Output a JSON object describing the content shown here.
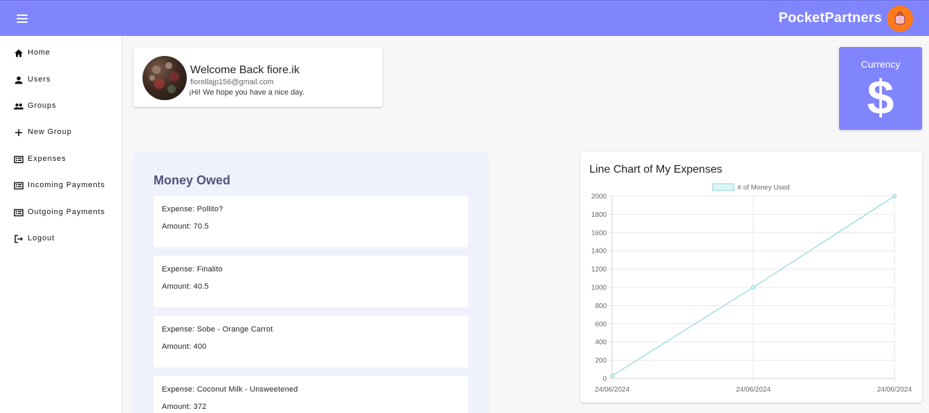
{
  "appbar": {
    "brand": "PocketPartners",
    "accent_color": "#8085fe",
    "menu_icon": "hamburger-icon",
    "logo_icon": "pocket-logo-icon"
  },
  "sidebar": {
    "items": [
      {
        "label": "Home",
        "icon": "home-icon"
      },
      {
        "label": "Users",
        "icon": "user-icon"
      },
      {
        "label": "Groups",
        "icon": "group-icon"
      },
      {
        "label": "New Group",
        "icon": "plus-icon"
      },
      {
        "label": "Expenses",
        "icon": "list-icon"
      },
      {
        "label": "Incoming Payments",
        "icon": "list-icon"
      },
      {
        "label": "Outgoing Payments",
        "icon": "list-icon"
      },
      {
        "label": "Logout",
        "icon": "logout-icon"
      }
    ]
  },
  "welcome": {
    "title": "Welcome Back fiore.ik",
    "email": "fiorellajp156@gmail.com",
    "message": "¡Hi! We hope you have a nice day."
  },
  "currency": {
    "label": "Currency",
    "symbol": "$"
  },
  "money_owed": {
    "title": "Money Owed",
    "items": [
      {
        "expense": "Expense: Pollito?",
        "amount": "Amount: 70.5"
      },
      {
        "expense": "Expense: Finalito",
        "amount": "Amount: 40.5"
      },
      {
        "expense": "Expense: Sobe - Orange Carrot",
        "amount": "Amount: 400"
      },
      {
        "expense": "Expense: Coconut Milk - Unsweetened",
        "amount": "Amount: 372"
      }
    ]
  },
  "chart": {
    "title": "Line Chart of My Expenses"
  },
  "chart_data": {
    "type": "line",
    "title": "Line Chart of My Expenses",
    "categories": [
      "24/06/2024",
      "24/06/2024",
      "24/06/2024"
    ],
    "series": [
      {
        "name": "# of Money Used",
        "values": [
          30,
          1000,
          2000
        ],
        "color": "#8fd3de"
      }
    ],
    "ylim": [
      0,
      2000
    ],
    "yticks": [
      0,
      200,
      400,
      600,
      800,
      1000,
      1200,
      1400,
      1600,
      1800,
      2000
    ],
    "grid": true,
    "legend": "top-center"
  }
}
